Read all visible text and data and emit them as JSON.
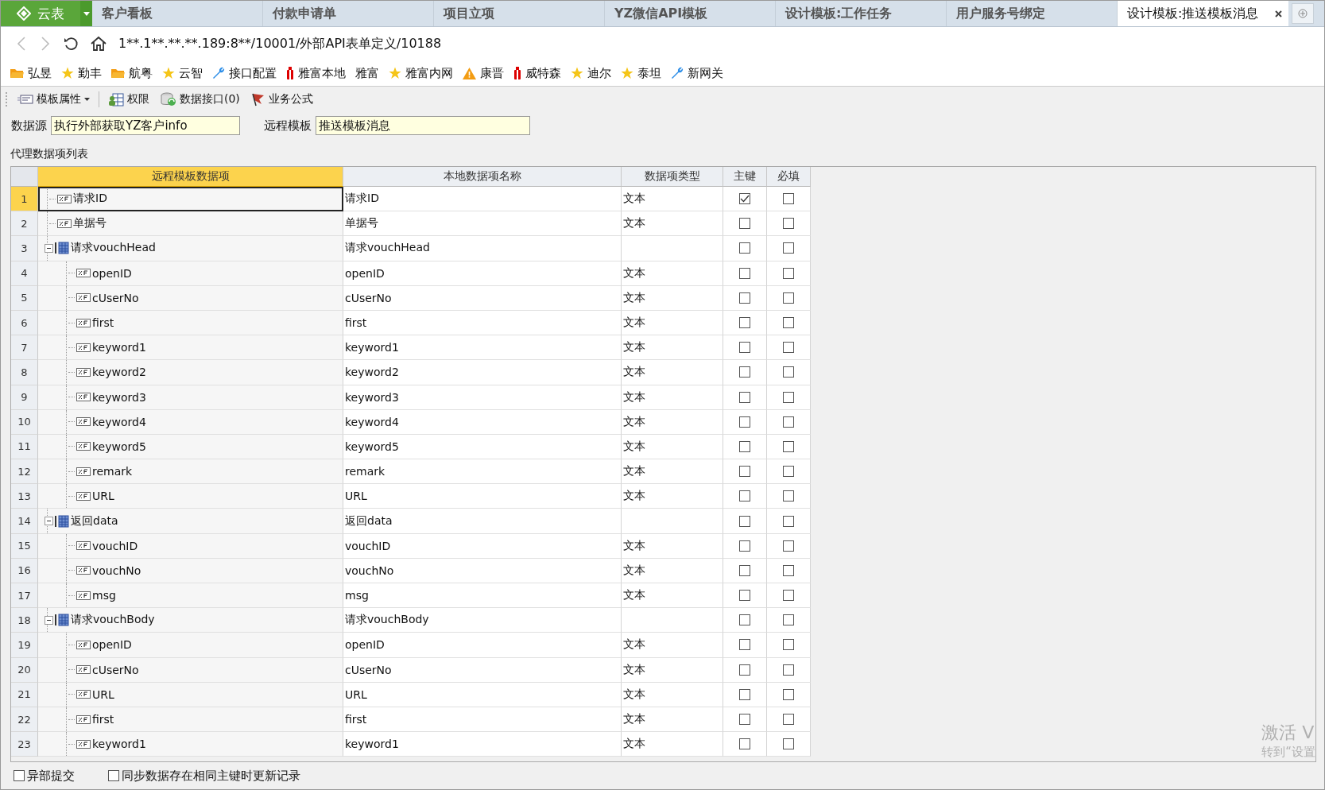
{
  "tabs": [
    {
      "label": "云表",
      "kind": "home",
      "selected": false
    },
    {
      "label": "客户看板",
      "kind": "tab",
      "selected": false
    },
    {
      "label": "付款申请单",
      "kind": "tab",
      "selected": false
    },
    {
      "label": "项目立项",
      "kind": "tab",
      "selected": false
    },
    {
      "label": "YZ微信API模板",
      "kind": "tab",
      "selected": false
    },
    {
      "label": "设计模板:工作任务",
      "kind": "tab",
      "selected": false
    },
    {
      "label": "用户服务号绑定",
      "kind": "tab",
      "selected": false
    },
    {
      "label": "设计模板:推送模板消息",
      "kind": "tab",
      "selected": true
    }
  ],
  "address": "1**.1**.**.**.189:8**/10001/外部API表单定义/10188",
  "bookmarks": [
    {
      "label": "弘昱",
      "kind": "folder"
    },
    {
      "label": "勤丰",
      "kind": "star"
    },
    {
      "label": "航粤",
      "kind": "folder"
    },
    {
      "label": "云智",
      "kind": "star"
    },
    {
      "label": "接口配置",
      "kind": "wrench"
    },
    {
      "label": "雅富本地",
      "kind": "gift"
    },
    {
      "label": "雅富",
      "kind": "none"
    },
    {
      "label": "雅富内网",
      "kind": "star"
    },
    {
      "label": "康晋",
      "kind": "warning"
    },
    {
      "label": "威特森",
      "kind": "gift"
    },
    {
      "label": "迪尔",
      "kind": "star"
    },
    {
      "label": "泰坦",
      "kind": "star"
    },
    {
      "label": "新网关",
      "kind": "wrench"
    }
  ],
  "toolbar": [
    {
      "label": "模板属性",
      "kind": "properties"
    },
    {
      "label": "权限",
      "kind": "permissions"
    },
    {
      "label": "数据接口(0)",
      "kind": "interface"
    },
    {
      "label": "业务公式",
      "kind": "formula"
    }
  ],
  "form": {
    "datasource_label": "数据源",
    "datasource": "执行外部获取YZ客户info",
    "template_label": "远程模板",
    "template": "推送模板消息"
  },
  "list_title": "代理数据项列表",
  "table": {
    "columns": [
      "远程模板数据项",
      "本地数据项名称",
      "数据项类型",
      "主键",
      "必填"
    ],
    "rows": [
      {
        "num": "1",
        "name": "请求ID",
        "local": "请求ID",
        "type": "文本",
        "kind": "field",
        "primary": true,
        "required": false,
        "selected": true
      },
      {
        "num": "2",
        "name": "单据号",
        "local": "单据号",
        "type": "文本",
        "kind": "field",
        "primary": false,
        "required": false,
        "selected": false
      },
      {
        "num": "3",
        "name": "请求vouchHead",
        "local": "请求vouchHead",
        "kind": "group",
        "expanded": true,
        "primary": false,
        "required": false,
        "selected": false,
        "children": [
          {
            "num": "4",
            "name": "openID",
            "local": "openID",
            "type": "文本",
            "kind": "field",
            "primary": false,
            "required": false,
            "selected": false
          },
          {
            "num": "5",
            "name": "cUserNo",
            "local": "cUserNo",
            "type": "文本",
            "kind": "field",
            "primary": false,
            "required": false,
            "selected": false
          },
          {
            "num": "6",
            "name": "first",
            "local": "first",
            "type": "文本",
            "kind": "field",
            "primary": false,
            "required": false,
            "selected": false
          },
          {
            "num": "7",
            "name": "keyword1",
            "local": "keyword1",
            "type": "文本",
            "kind": "field",
            "primary": false,
            "required": false,
            "selected": false
          },
          {
            "num": "8",
            "name": "keyword2",
            "local": "keyword2",
            "type": "文本",
            "kind": "field",
            "primary": false,
            "required": false,
            "selected": false
          },
          {
            "num": "9",
            "name": "keyword3",
            "local": "keyword3",
            "type": "文本",
            "kind": "field",
            "primary": false,
            "required": false,
            "selected": false
          },
          {
            "num": "10",
            "name": "keyword4",
            "local": "keyword4",
            "type": "文本",
            "kind": "field",
            "primary": false,
            "required": false,
            "selected": false
          },
          {
            "num": "11",
            "name": "keyword5",
            "local": "keyword5",
            "type": "文本",
            "kind": "field",
            "primary": false,
            "required": false,
            "selected": false
          },
          {
            "num": "12",
            "name": "remark",
            "local": "remark",
            "type": "文本",
            "kind": "field",
            "primary": false,
            "required": false,
            "selected": false
          },
          {
            "num": "13",
            "name": "URL",
            "local": "URL",
            "type": "文本",
            "kind": "field",
            "primary": false,
            "required": false,
            "selected": false
          }
        ]
      },
      {
        "num": "14",
        "name": "返回data",
        "local": "返回data",
        "kind": "group",
        "expanded": true,
        "primary": false,
        "required": false,
        "selected": false,
        "children": [
          {
            "num": "15",
            "name": "vouchID",
            "local": "vouchID",
            "type": "文本",
            "kind": "field",
            "primary": false,
            "required": false,
            "selected": false
          },
          {
            "num": "16",
            "name": "vouchNo",
            "local": "vouchNo",
            "type": "文本",
            "kind": "field",
            "primary": false,
            "required": false,
            "selected": false
          },
          {
            "num": "17",
            "name": "msg",
            "local": "msg",
            "type": "文本",
            "kind": "field",
            "primary": false,
            "required": false,
            "selected": false
          }
        ]
      },
      {
        "num": "18",
        "name": "请求vouchBody",
        "local": "请求vouchBody",
        "kind": "group",
        "expanded": true,
        "primary": false,
        "required": false,
        "selected": false,
        "children": [
          {
            "num": "19",
            "name": "openID",
            "local": "openID",
            "type": "文本",
            "kind": "field",
            "primary": false,
            "required": false,
            "selected": false
          },
          {
            "num": "20",
            "name": "cUserNo",
            "local": "cUserNo",
            "type": "文本",
            "kind": "field",
            "primary": false,
            "required": false,
            "selected": false
          },
          {
            "num": "21",
            "name": "URL",
            "local": "URL",
            "type": "文本",
            "kind": "field",
            "primary": false,
            "required": false,
            "selected": false
          },
          {
            "num": "22",
            "name": "first",
            "local": "first",
            "type": "文本",
            "kind": "field",
            "primary": false,
            "required": false,
            "selected": false
          },
          {
            "num": "23",
            "name": "keyword1",
            "local": "keyword1",
            "type": "文本",
            "kind": "field",
            "primary": false,
            "required": false,
            "selected": false
          }
        ]
      }
    ]
  },
  "footer": [
    {
      "label": "异部提交",
      "checked": false
    },
    {
      "label": "同步数据存在相同主键时更新记录",
      "checked": false
    }
  ],
  "activation_notice": [
    "激活 V",
    "转到“设置"
  ]
}
